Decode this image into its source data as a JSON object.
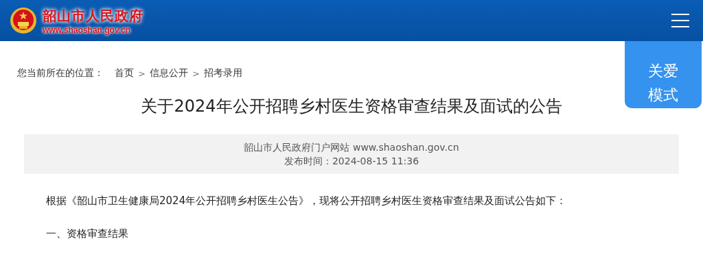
{
  "header": {
    "site_name": "韶山市人民政府",
    "site_url": "www.shaoshan.gov.cn"
  },
  "care_mode": {
    "lines": [
      "关爱",
      "模式"
    ]
  },
  "breadcrumb": {
    "prefix": "您当前所在的位置：",
    "items": [
      {
        "kind": "link",
        "text": "首页"
      },
      {
        "kind": "sep",
        "text": ">"
      },
      {
        "kind": "link",
        "text": "信息公开"
      },
      {
        "kind": "sep",
        "text": ">"
      },
      {
        "kind": "link",
        "text": "招考录用"
      }
    ]
  },
  "article": {
    "title": "关于2024年公开招聘乡村医生资格审查结果及面试的公告",
    "source": "韶山市人民政府门户网站 www.shaoshan.gov.cn",
    "published": "发布时间：2024-08-15 11:36",
    "paragraphs": [
      "根据《韶山市卫生健康局2024年公开招聘乡村医生公告》，现将公开招聘乡村医生资格审查结果及面试公告如下：",
      "一、资格审查结果"
    ]
  }
}
